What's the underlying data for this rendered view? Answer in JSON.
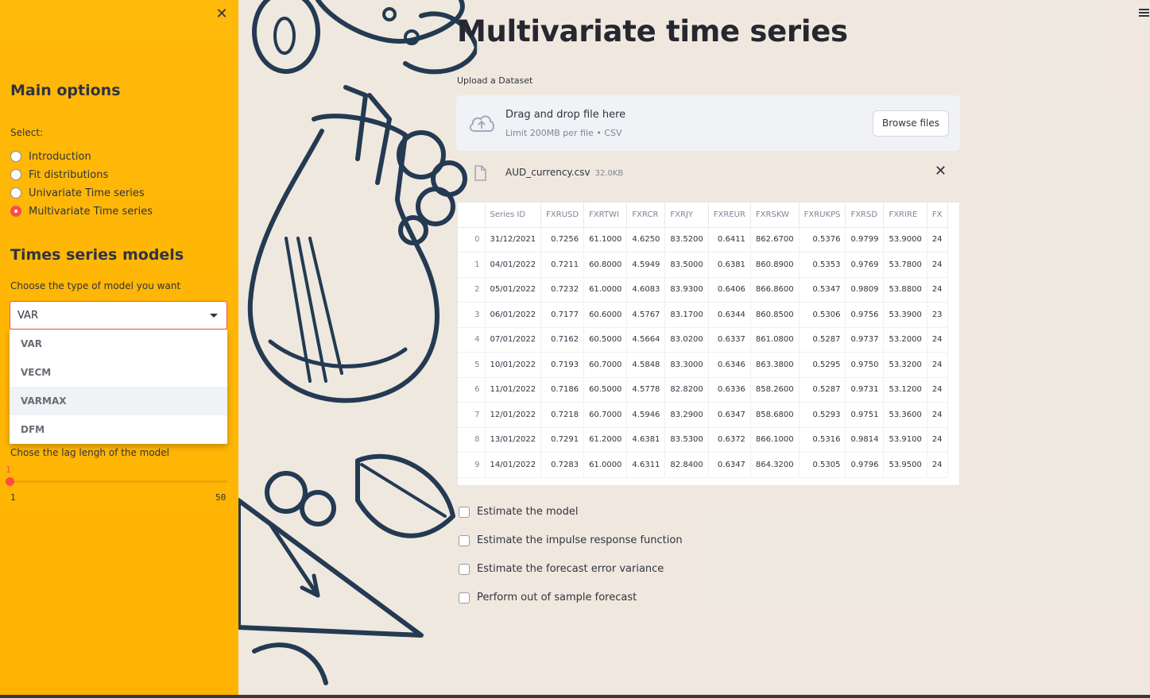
{
  "sidebar": {
    "main_options_title": "Main options",
    "select_label": "Select:",
    "radio_options": [
      {
        "label": "Introduction",
        "selected": false
      },
      {
        "label": "Fit distributions",
        "selected": false
      },
      {
        "label": "Univariate Time series",
        "selected": false
      },
      {
        "label": "Multivariate Time series",
        "selected": true
      }
    ],
    "models_title": "Times series models",
    "model_select_label": "Choose the type of model you want",
    "model_selected": "VAR",
    "model_options": [
      "VAR",
      "VECM",
      "VARMAX",
      "DFM"
    ],
    "lag_label": "Chose the lag lengh of the model",
    "lag_value": "1",
    "lag_min": "1",
    "lag_max": "50"
  },
  "main": {
    "title": "Multivariate time series",
    "upload_label": "Upload a Dataset",
    "dropzone_title": "Drag and drop file here",
    "dropzone_sub": "Limit 200MB per file • CSV",
    "browse_label": "Browse files",
    "file_name": "AUD_currency.csv",
    "file_size": "32.0KB",
    "table": {
      "columns": [
        "",
        "Series ID",
        "FXRUSD",
        "FXRTWI",
        "FXRCR",
        "FXRJY",
        "FXREUR",
        "FXRSKW",
        "FXRUKPS",
        "FXRSD",
        "FXRIRE",
        "FX"
      ],
      "rows": [
        [
          "0",
          "31/12/2021",
          "0.7256",
          "61.1000",
          "4.6250",
          "83.5200",
          "0.6411",
          "862.6700",
          "0.5376",
          "0.9799",
          "53.9000",
          "24"
        ],
        [
          "1",
          "04/01/2022",
          "0.7211",
          "60.8000",
          "4.5949",
          "83.5000",
          "0.6381",
          "860.8900",
          "0.5353",
          "0.9769",
          "53.7800",
          "24"
        ],
        [
          "2",
          "05/01/2022",
          "0.7232",
          "61.0000",
          "4.6083",
          "83.9300",
          "0.6406",
          "866.8600",
          "0.5347",
          "0.9809",
          "53.8800",
          "24"
        ],
        [
          "3",
          "06/01/2022",
          "0.7177",
          "60.6000",
          "4.5767",
          "83.1700",
          "0.6344",
          "860.8500",
          "0.5306",
          "0.9756",
          "53.3900",
          "23"
        ],
        [
          "4",
          "07/01/2022",
          "0.7162",
          "60.5000",
          "4.5664",
          "83.0200",
          "0.6337",
          "861.0800",
          "0.5287",
          "0.9737",
          "53.2000",
          "24"
        ],
        [
          "5",
          "10/01/2022",
          "0.7193",
          "60.7000",
          "4.5848",
          "83.3000",
          "0.6346",
          "863.3800",
          "0.5295",
          "0.9750",
          "53.3200",
          "24"
        ],
        [
          "6",
          "11/01/2022",
          "0.7186",
          "60.5000",
          "4.5778",
          "82.8200",
          "0.6336",
          "858.2600",
          "0.5287",
          "0.9731",
          "53.1200",
          "24"
        ],
        [
          "7",
          "12/01/2022",
          "0.7218",
          "60.7000",
          "4.5946",
          "83.2900",
          "0.6347",
          "858.6800",
          "0.5293",
          "0.9751",
          "53.3600",
          "24"
        ],
        [
          "8",
          "13/01/2022",
          "0.7291",
          "61.2000",
          "4.6381",
          "83.5300",
          "0.6372",
          "866.1000",
          "0.5316",
          "0.9814",
          "53.9100",
          "24"
        ],
        [
          "9",
          "14/01/2022",
          "0.7283",
          "61.0000",
          "4.6311",
          "82.8400",
          "0.6347",
          "864.3200",
          "0.5305",
          "0.9796",
          "53.9500",
          "24"
        ]
      ]
    },
    "checkboxes": [
      "Estimate the model",
      "Estimate the impulse response function",
      "Estimate the forecast error variance",
      "Perform out of sample forecast"
    ]
  },
  "colors": {
    "sidebar_bg": "#ffb703",
    "accent": "#ff4b4b",
    "text": "#31333f"
  }
}
